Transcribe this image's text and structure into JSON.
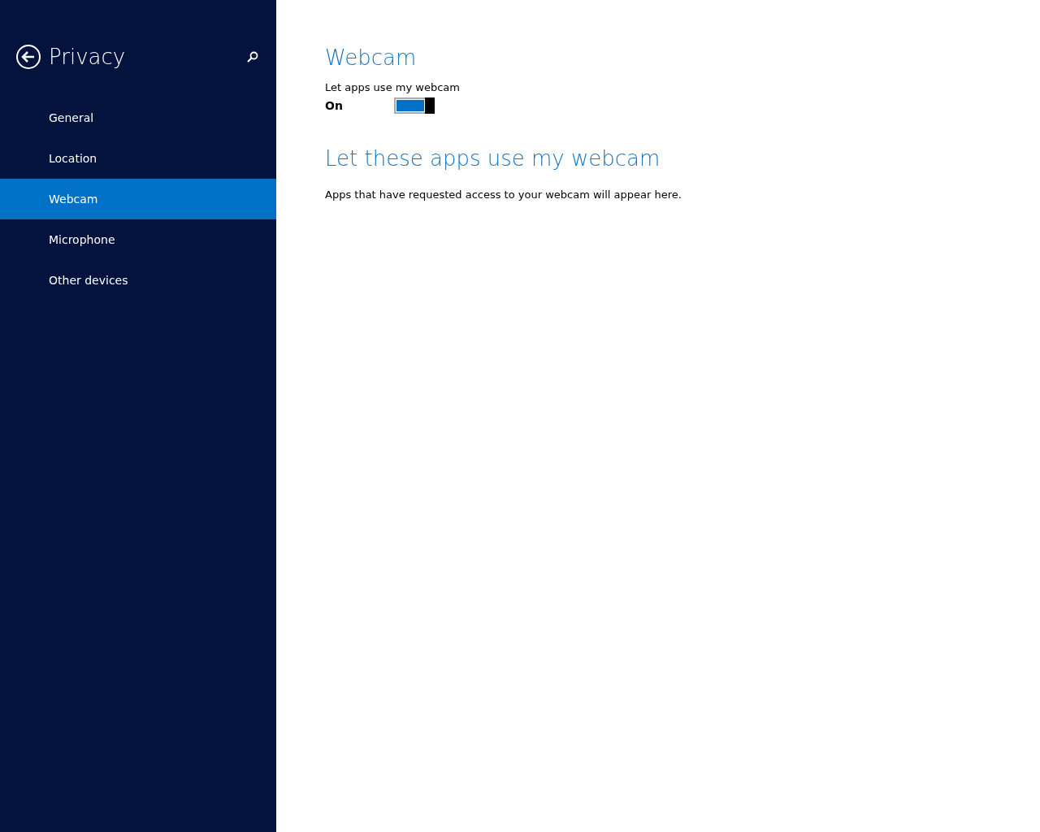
{
  "sidebar": {
    "title": "Privacy",
    "items": [
      {
        "label": "General",
        "selected": false
      },
      {
        "label": "Location",
        "selected": false
      },
      {
        "label": "Webcam",
        "selected": true
      },
      {
        "label": "Microphone",
        "selected": false
      },
      {
        "label": "Other devices",
        "selected": false
      }
    ]
  },
  "content": {
    "title": "Webcam",
    "toggle": {
      "label": "Let apps use my webcam",
      "state_text": "On",
      "on": true
    },
    "section_title": "Let these apps use my webcam",
    "description": "Apps that have requested access to your webcam will appear here."
  }
}
